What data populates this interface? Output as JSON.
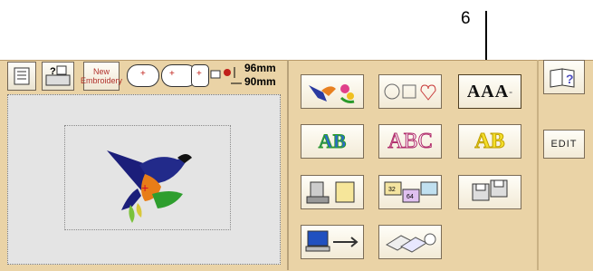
{
  "callout": {
    "number": "6"
  },
  "toolbar": {
    "new_embroidery_line1": "New",
    "new_embroidery_line2": "Embroidery",
    "width_value": "96mm",
    "height_value": "90mm"
  },
  "patterns": {
    "alphabet_label": "ABC",
    "ab_label": "AB",
    "fonts_label": "AAA",
    "mini_32": "32",
    "mini_64": "64"
  },
  "right": {
    "edit_label": "EDIT"
  },
  "colors": {
    "screen_bg": "#ead3a6",
    "preview_bg": "#e4e4e4",
    "button_border": "#7b6c57"
  }
}
